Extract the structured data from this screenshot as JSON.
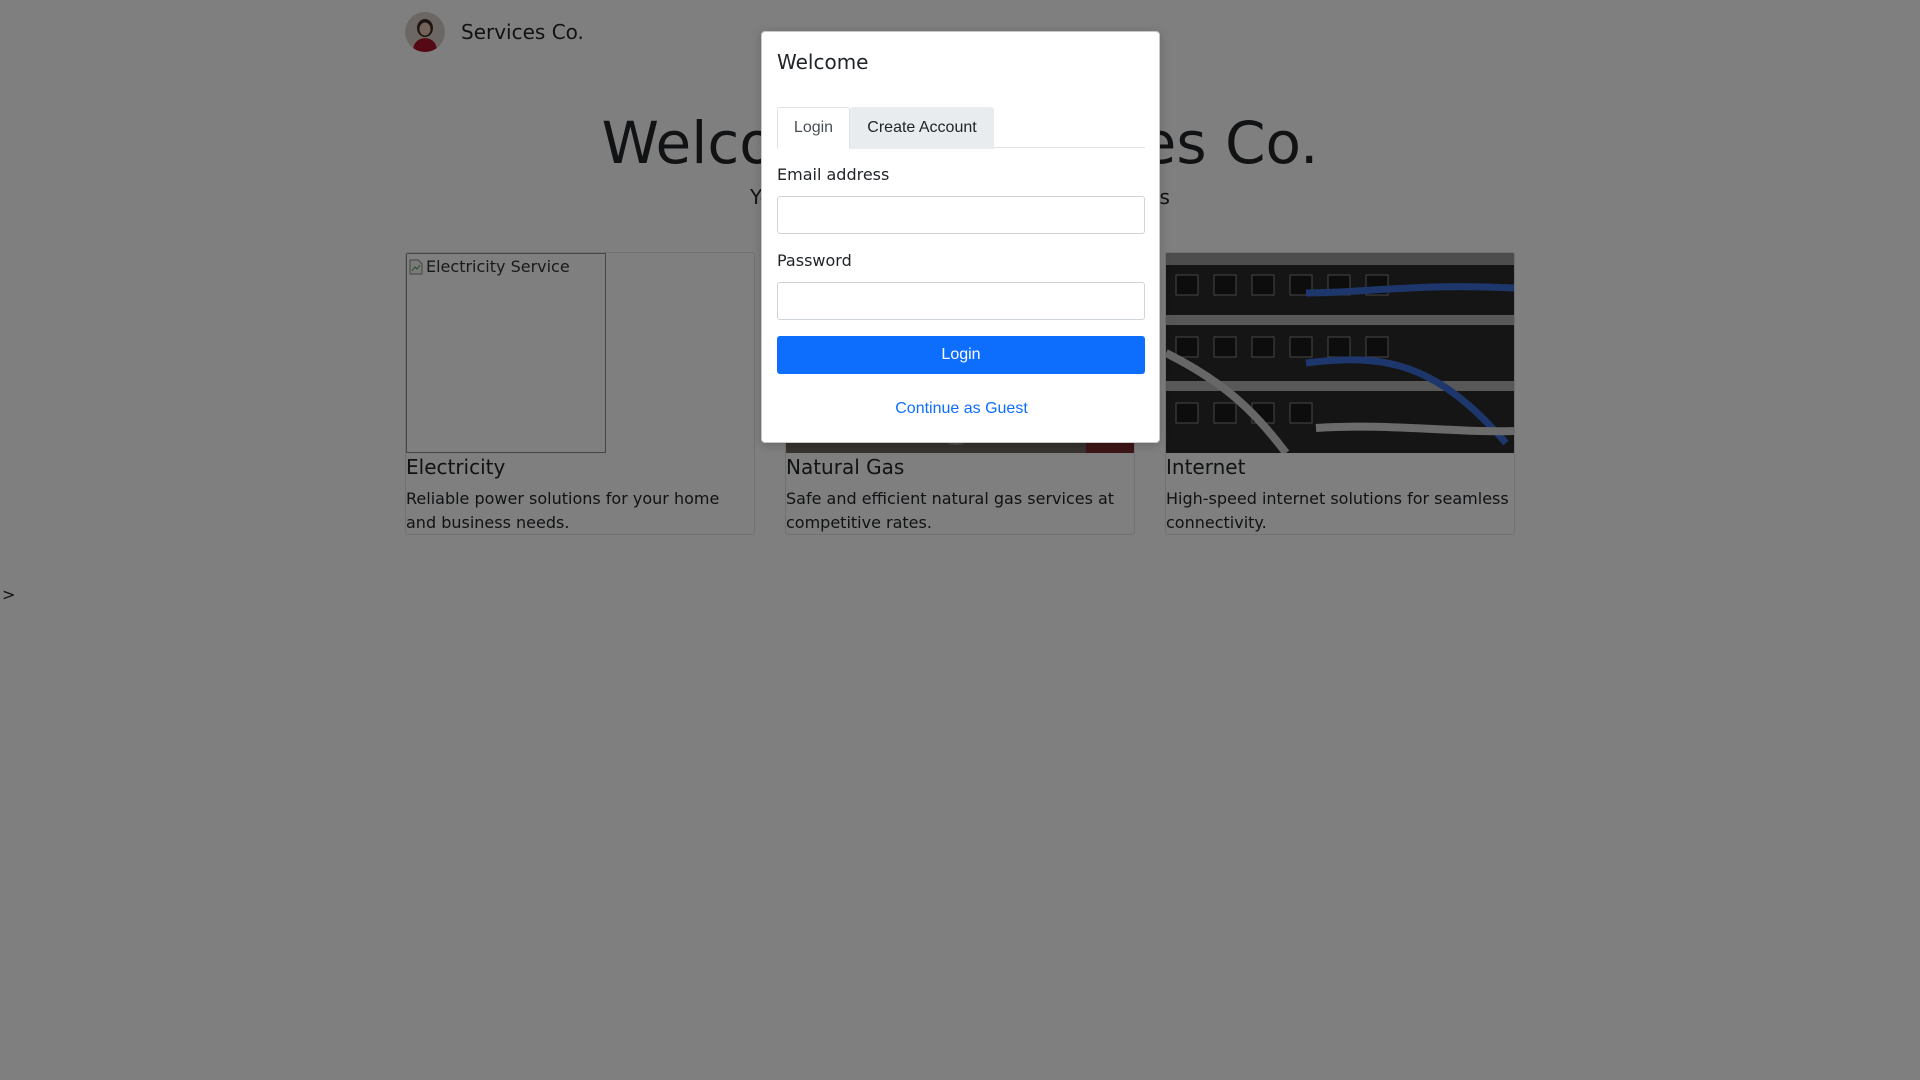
{
  "header": {
    "brand": "Services Co."
  },
  "hero": {
    "title": "Welcome to Services Co.",
    "subtitle": "Your trusted provider for essential utilities"
  },
  "cards": [
    {
      "title": "Electricity",
      "image_alt": "Electricity Service",
      "text": "Reliable power solutions for your home and business needs."
    },
    {
      "title": "Natural Gas",
      "text": "Safe and efficient natural gas services at competitive rates."
    },
    {
      "title": "Internet",
      "text": "High-speed internet solutions for seamless connectivity."
    }
  ],
  "stray_text": ">",
  "modal": {
    "title": "Welcome",
    "tabs": [
      {
        "label": "Login",
        "active": true
      },
      {
        "label": "Create Account",
        "active": false
      }
    ],
    "email_label": "Email address",
    "email_value": "",
    "password_label": "Password",
    "password_value": "",
    "login_button": "Login",
    "guest_link": "Continue as Guest"
  },
  "colors": {
    "primary": "#0d6efd",
    "overlay": "rgba(0,0,0,0.5)",
    "tab_inactive_bg": "#e9ecef"
  }
}
